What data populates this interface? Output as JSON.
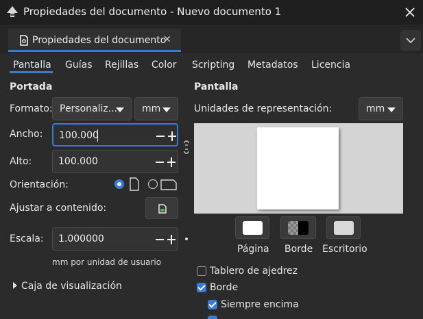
{
  "window": {
    "title": "Propiedades del documento - Nuevo documento 1"
  },
  "tab": {
    "label": "Propiedades del documento"
  },
  "subtabs": [
    "Pantalla",
    "Guías",
    "Rejillas",
    "Color",
    "Scripting",
    "Metadatos",
    "Licencia"
  ],
  "left": {
    "section_title": "Portada",
    "format_label": "Formato:",
    "format_value": "Personaliz...",
    "unit_value": "mm",
    "width_label": "Ancho:",
    "width_value": "100.000",
    "height_label": "Alto:",
    "height_value": "100.000",
    "orientation_label": "Orientación:",
    "orientation_selected": "portrait",
    "fit_label": "Ajustar a contenido:",
    "scale_label": "Escala:",
    "scale_value": "1.000000",
    "scale_unit_note": "mm por unidad de usuario",
    "viewbox_label": "Caja de visualización"
  },
  "right": {
    "section_title": "Pantalla",
    "display_units_label": "Unidades de representación:",
    "display_units_value": "mm",
    "page_color_label": "Página",
    "border_color_label": "Borde",
    "desk_color_label": "Escritorio",
    "checkerboard_label": "Tablero de ajedrez",
    "checkerboard_checked": false,
    "border_label": "Borde",
    "border_checked": true,
    "always_on_top_label": "Siempre encima",
    "always_on_top_checked": true
  },
  "colors": {
    "accent": "#3a7bd5",
    "background": "#2b2b2b",
    "preview_bg": "#d4d4d4",
    "page": "#ffffff",
    "desk": "#d9d9d9"
  }
}
